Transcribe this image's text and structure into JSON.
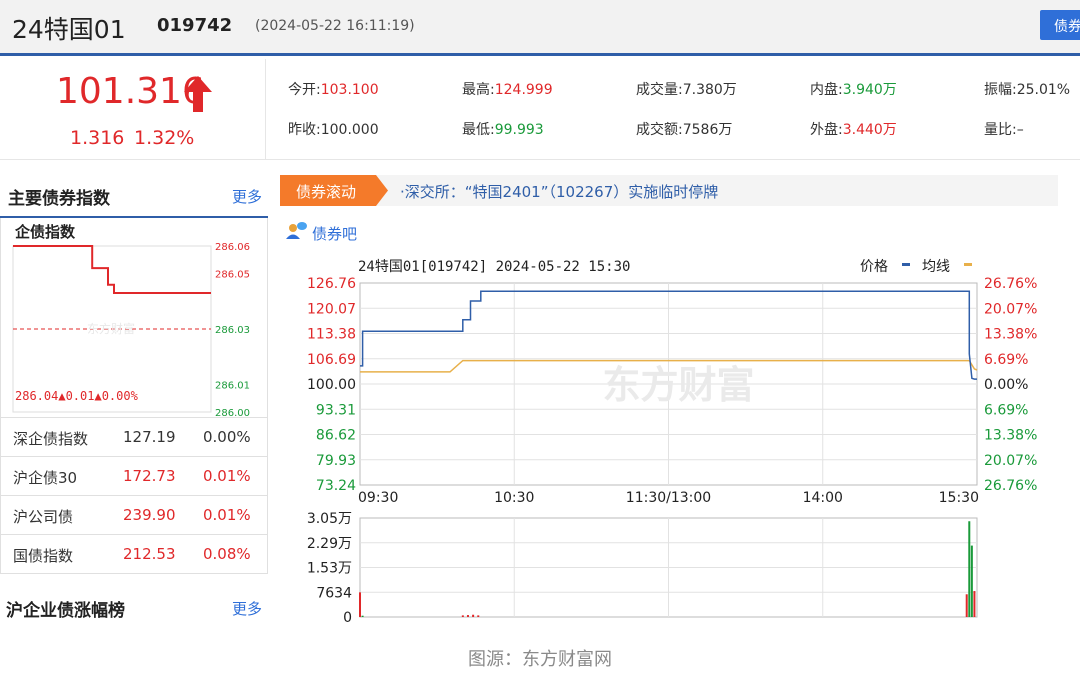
{
  "header": {
    "name": "24特国01",
    "code": "019742",
    "datetime": "(2024-05-22 16:11:19)",
    "button_label": "债券"
  },
  "quote": {
    "price": "101.316",
    "change": "1.316",
    "change_pct": "1.32%",
    "stats": [
      {
        "label": "今开:",
        "value": "103.100",
        "color": "red"
      },
      {
        "label": "最高:",
        "value": "124.999",
        "color": "red"
      },
      {
        "label": "成交量:",
        "value": "7.380万",
        "color": "plain"
      },
      {
        "label": "内盘:",
        "value": "3.940万",
        "color": "green"
      },
      {
        "label": "振幅:",
        "value": "25.01%",
        "color": "plain"
      },
      {
        "label": "昨收:",
        "value": "100.000",
        "color": "plain"
      },
      {
        "label": "最低:",
        "value": "99.993",
        "color": "green"
      },
      {
        "label": "成交额:",
        "value": "7586万",
        "color": "plain"
      },
      {
        "label": "外盘:",
        "value": "3.440万",
        "color": "red"
      },
      {
        "label": "量比:",
        "value": "–",
        "color": "plain"
      }
    ]
  },
  "left": {
    "section_title": "主要债券指数",
    "more_label": "更多",
    "mini_chart": {
      "title": "企债指数",
      "y_ticks": [
        "286.06",
        "286.05",
        "286.03",
        "286.01",
        "286.00"
      ],
      "summary": "286.04▲0.01▲0.00%",
      "watermark": "东方财富"
    },
    "indices": [
      {
        "name": "深企债指数",
        "value": "127.19",
        "pct": "0.00%",
        "color": "plain"
      },
      {
        "name": "沪企债30",
        "value": "172.73",
        "pct": "0.01%",
        "color": "red"
      },
      {
        "name": "沪公司债",
        "value": "239.90",
        "pct": "0.01%",
        "color": "red"
      },
      {
        "name": "国债指数",
        "value": "212.53",
        "pct": "0.08%",
        "color": "red"
      }
    ],
    "section2_title": "沪企业债涨幅榜",
    "section2_more": "更多"
  },
  "ticker": {
    "tag": "债券滚动",
    "news": "·深交所：“特国2401”（102267）实施临时停牌"
  },
  "forum": {
    "label": "债券吧",
    "icon": "user-chat-icon"
  },
  "chart_data": {
    "type": "line",
    "title": "24特国01[019742] 2024-05-22 15:30",
    "legend": [
      {
        "name": "价格",
        "color": "#2f5ea8"
      },
      {
        "name": "均线",
        "color": "#e8b04a"
      }
    ],
    "legend_position": "top-right",
    "y_left_ticks": [
      "126.76",
      "120.07",
      "113.38",
      "106.69",
      "100.00",
      "93.31",
      "86.62",
      "79.93",
      "73.24"
    ],
    "y_right_ticks": [
      "26.76%",
      "20.07%",
      "13.38%",
      "6.69%",
      "0.00%",
      "6.69%",
      "13.38%",
      "20.07%",
      "26.76%"
    ],
    "x_ticks": [
      "09:30",
      "10:30",
      "11:30/13:00",
      "14:00",
      "15:30"
    ],
    "ylim": [
      73.24,
      126.76
    ],
    "x_minutes_range": [
      0,
      240
    ],
    "grid": true,
    "watermark": "东方财富",
    "price_series": {
      "name": "价格",
      "x": [
        0,
        1,
        1,
        40,
        40,
        43,
        43,
        47,
        47,
        237,
        237,
        238,
        239,
        240
      ],
      "y": [
        104.8,
        104.8,
        114.0,
        114.0,
        117.0,
        117.0,
        122.0,
        122.0,
        124.6,
        124.6,
        108.0,
        101.5,
        101.3,
        101.3
      ]
    },
    "avg_series": {
      "name": "均线",
      "x": [
        0,
        35,
        40,
        237,
        239,
        240
      ],
      "y": [
        103.2,
        103.2,
        106.2,
        106.2,
        104.0,
        103.7
      ]
    },
    "volume": {
      "y_ticks": [
        "3.05万",
        "2.29万",
        "1.53万",
        "7634",
        "0"
      ],
      "ylim": [
        0,
        30500
      ],
      "bars": [
        {
          "x": 0,
          "v": 7600,
          "color": "#e0282a"
        },
        {
          "x": 1,
          "v": 400,
          "color": "#1a9a3a"
        },
        {
          "x": 40,
          "v": 500,
          "color": "#e0282a"
        },
        {
          "x": 42,
          "v": 600,
          "color": "#e0282a"
        },
        {
          "x": 44,
          "v": 700,
          "color": "#e0282a"
        },
        {
          "x": 46,
          "v": 500,
          "color": "#e0282a"
        },
        {
          "x": 236,
          "v": 7000,
          "color": "#e0282a"
        },
        {
          "x": 237,
          "v": 29500,
          "color": "#1a9a3a"
        },
        {
          "x": 238,
          "v": 22000,
          "color": "#1a9a3a"
        },
        {
          "x": 239,
          "v": 8000,
          "color": "#e0282a"
        }
      ]
    }
  },
  "mini_data": {
    "type": "line",
    "ylim": [
      286.0,
      286.06
    ],
    "ref": 286.03,
    "x": [
      0,
      40,
      40,
      48,
      48,
      51,
      51,
      100
    ],
    "y": [
      286.06,
      286.06,
      286.052,
      286.052,
      286.046,
      286.046,
      286.043,
      286.043
    ]
  },
  "caption": "图源：东方财富网"
}
